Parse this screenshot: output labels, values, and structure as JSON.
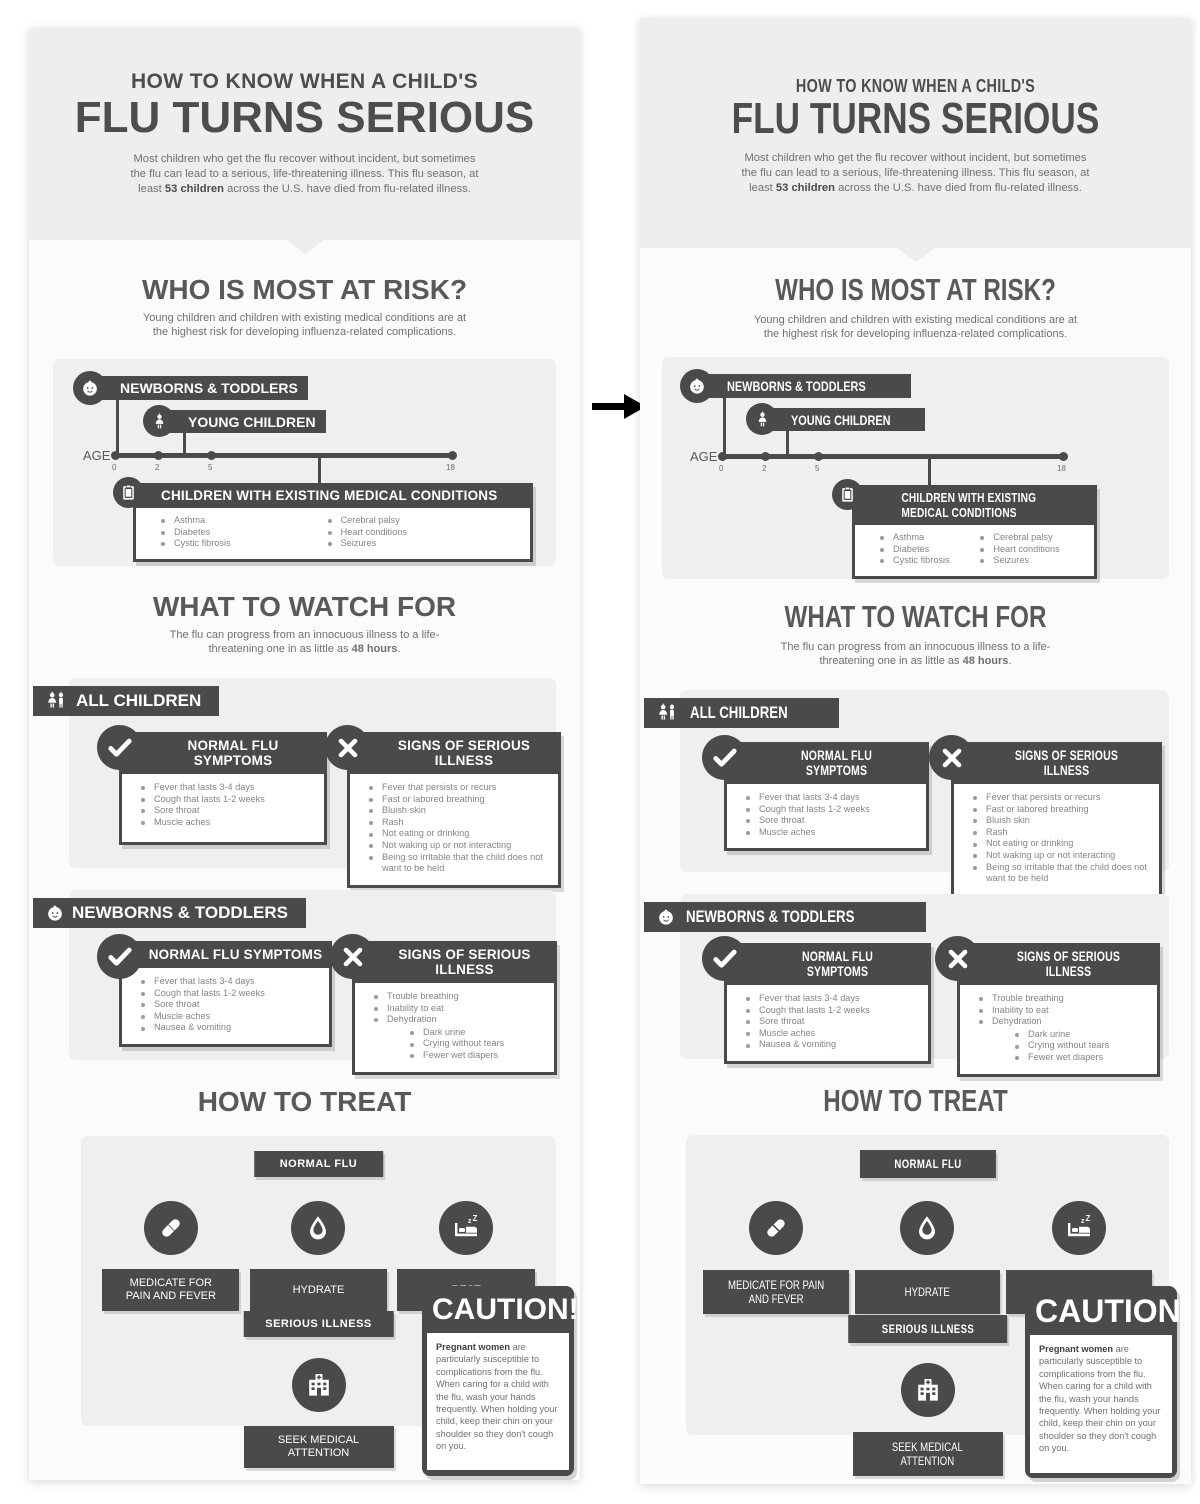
{
  "header": {
    "kicker": "HOW TO KNOW WHEN A CHILD'S",
    "title": "FLU TURNS SERIOUS",
    "intro_a": "Most children who get the flu recover without incident, but sometimes the flu can lead to a serious, life-threatening illness. This flu season, at least ",
    "intro_bold": "53 children",
    "intro_b": " across the U.S. have died from flu-related illness."
  },
  "risk": {
    "title": "WHO IS MOST AT RISK?",
    "subtitle": "Young children and children with existing medical conditions are at the highest risk for developing influenza-related complications.",
    "age_label": "AGE",
    "ticks": [
      "0",
      "2",
      "5",
      "18"
    ],
    "group_newborns": "NEWBORNS & TODDLERS",
    "group_young": "YOUNG CHILDREN",
    "group_medical": "CHILDREN WITH EXISTING MEDICAL CONDITIONS",
    "conditions_col1": [
      "Asthma",
      "Diabetes",
      "Cystic fibrosis"
    ],
    "conditions_col2": [
      "Cerebral palsy",
      "Heart conditions",
      "Seizures"
    ]
  },
  "watch": {
    "title": "WHAT TO WATCH FOR",
    "subtitle_a": "The flu can progress from an innocuous illness to a life-threatening one in as little as ",
    "subtitle_bold": "48 hours",
    "subtitle_b": ".",
    "all_children_band": "ALL CHILDREN",
    "newborns_band": "NEWBORNS & TODDLERS",
    "normal_header": "NORMAL FLU SYMPTOMS",
    "serious_header": "SIGNS OF SERIOUS ILLNESS",
    "all_normal": [
      "Fever that lasts 3-4 days",
      "Cough that lasts 1-2 weeks",
      "Sore throat",
      "Muscle aches"
    ],
    "all_serious": [
      "Fever that persists or recurs",
      "Fast or labored breathing",
      "Bluish skin",
      "Rash",
      "Not eating or drinking",
      "Not waking up or not interacting",
      "Being so irritable that the child does not want to be held"
    ],
    "newborn_normal": [
      "Fever that lasts 3-4 days",
      "Cough that lasts 1-2 weeks",
      "Sore throat",
      "Muscle aches",
      "Nausea & vomiting"
    ],
    "newborn_serious": [
      "Trouble breathing",
      "Inability to eat",
      "Dehydration"
    ],
    "newborn_serious_sub": [
      "Dark urine",
      "Crying without tears",
      "Fewer wet diapers"
    ]
  },
  "treat": {
    "title": "HOW TO TREAT",
    "normal_flu_label": "NORMAL FLU",
    "serious_label": "SERIOUS ILLNESS",
    "items": [
      {
        "icon": "pill-icon",
        "label_left": "MEDICATE FOR\nPAIN AND FEVER",
        "label_right": "MEDICATE FOR PAIN\nAND FEVER"
      },
      {
        "icon": "water-drop-icon",
        "label_left": "HYDRATE",
        "label_right": "HYDRATE"
      },
      {
        "icon": "bed-rest-icon",
        "label_left": "REST",
        "label_right": "REST"
      }
    ],
    "serious_item": {
      "icon": "hospital-icon",
      "label": "SEEK MEDICAL\nATTENTION"
    },
    "caution_title": "CAUTION!",
    "caution_bold": "Pregnant women",
    "caution_text": " are particularly susceptible to complications from the flu. When caring for a child with the flu, wash your hands frequently. When holding your child, keep their chin on your shoulder so they don't cough on you."
  },
  "colors": {
    "dark": "#4a4a4a",
    "panel_bg": "#fbfbfc",
    "hero_bg": "#eeeeee",
    "card_bg": "#efefef",
    "body_text": "#858585"
  },
  "arrow": "right-arrow-icon"
}
